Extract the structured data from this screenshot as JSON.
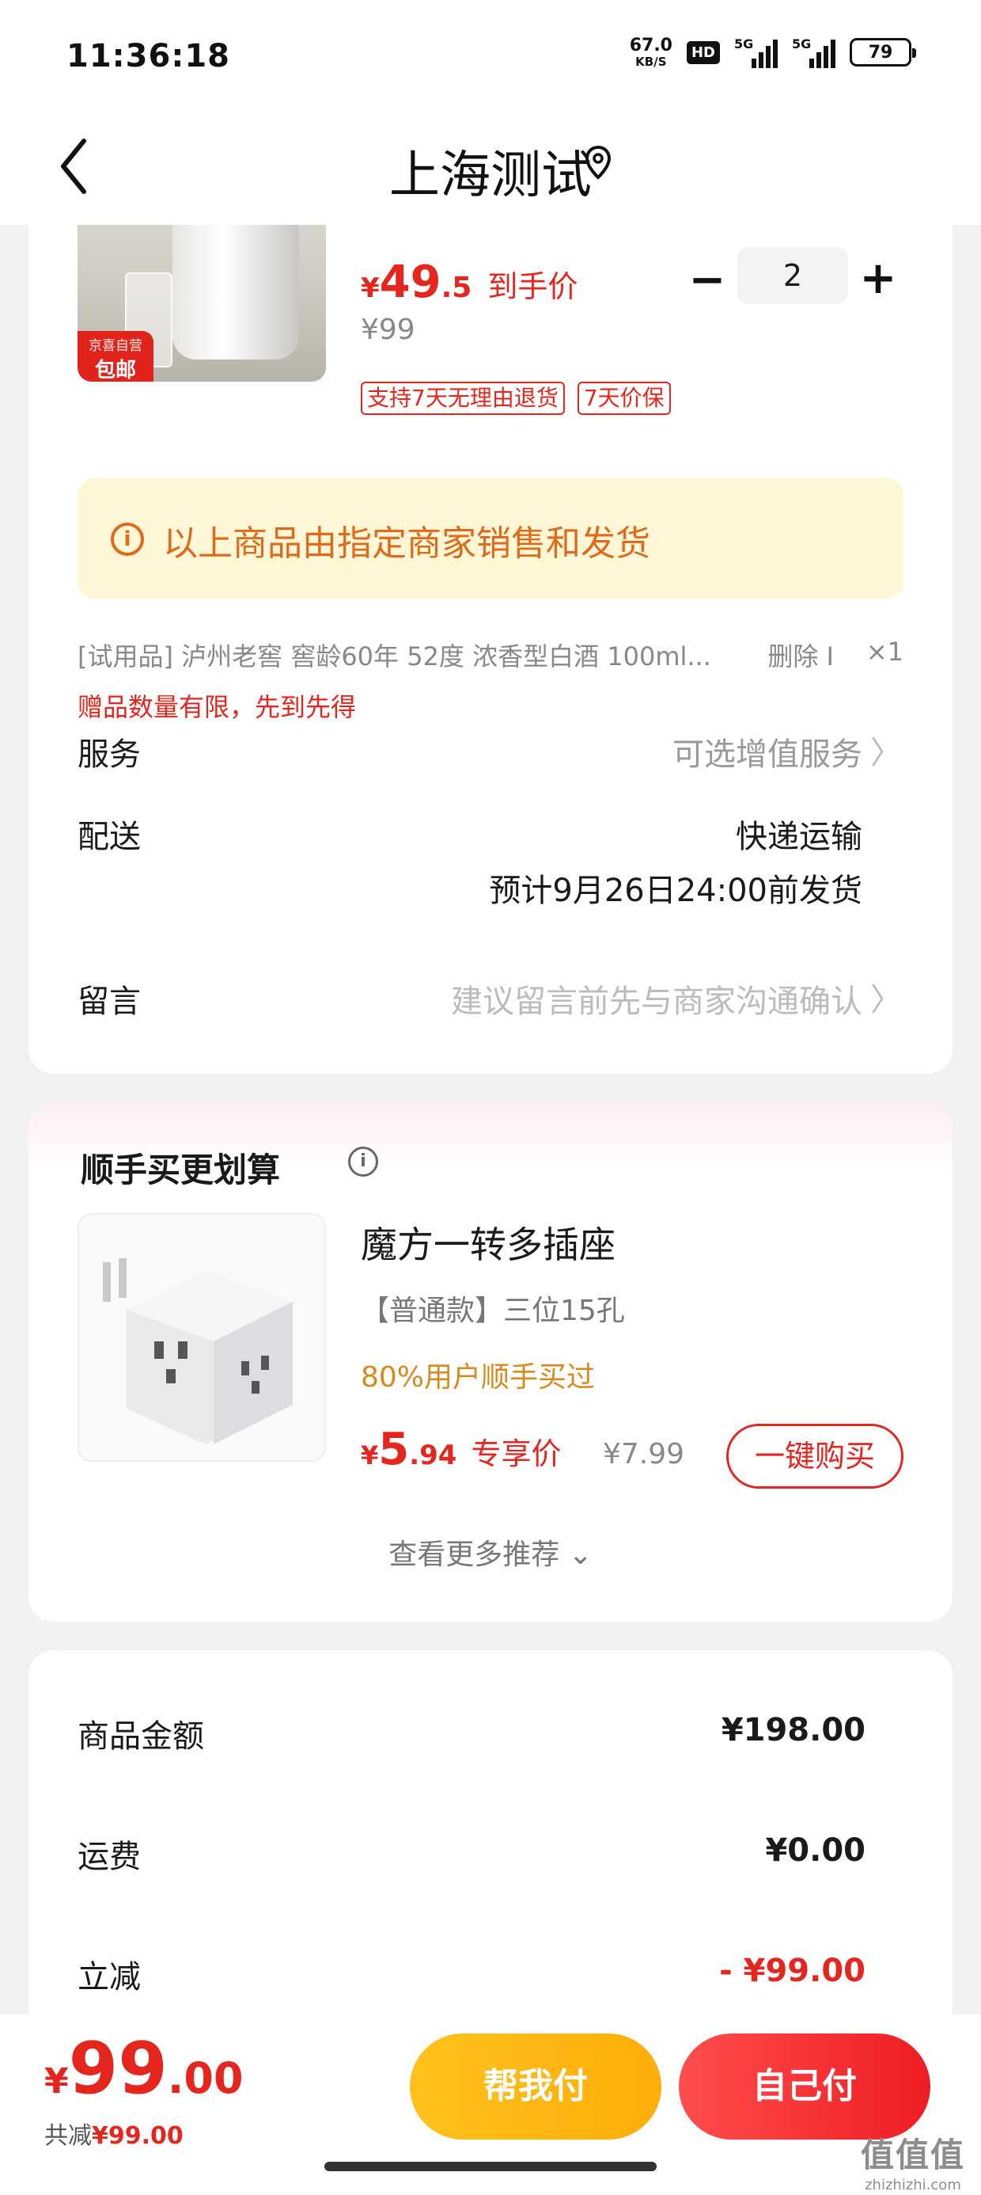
{
  "status_bar": {
    "time": "11:36:18",
    "net_speed_value": "67.0",
    "net_speed_unit": "KB/S",
    "hd": "HD",
    "signal1": "5G",
    "signal2": "5G",
    "battery": "79"
  },
  "header": {
    "title": "上海测试"
  },
  "product": {
    "badge_top": "京喜自营",
    "badge_bottom": "包邮",
    "price_symbol": "¥",
    "price_int": "49",
    "price_dec": ".5",
    "price_label": "到手价",
    "original_price": "¥99",
    "quantity": "2",
    "minus": "−",
    "plus": "+",
    "tags": [
      "支持7天无理由退货",
      "7天价保"
    ]
  },
  "notice": {
    "icon": "i",
    "text": "以上商品由指定商家销售和发货"
  },
  "gift": {
    "name": "[试用品]  泸州老窖 窖龄60年 52度 浓香型白酒 100ml...",
    "delete_label": "删除 I",
    "count": "×1",
    "note": "赠品数量有限，先到先得"
  },
  "service": {
    "label": "服务",
    "value": "可选增值服务"
  },
  "delivery": {
    "label": "配送",
    "method": "快递运输",
    "eta": "预计9月26日24:00前发货"
  },
  "message": {
    "label": "留言",
    "placeholder": "建议留言前先与商家沟通确认"
  },
  "recommend": {
    "title": "顺手买更划算",
    "info_icon": "i",
    "name": "魔方一转多插座",
    "spec": "【普通款】三位15孔",
    "popularity": "80%用户顺手买过",
    "price_symbol": "¥",
    "price_int": "5",
    "price_dec": ".94",
    "price_label": "专享价",
    "original_price": "¥7.99",
    "buy_label": "一键购买",
    "see_more": "查看更多推荐 ⌄"
  },
  "summary": {
    "goods_label": "商品金额",
    "goods_value": "¥198.00",
    "shipping_label": "运费",
    "shipping_value": "¥0.00",
    "discount_label": "立减",
    "discount_value": "- ¥99.00"
  },
  "bottom": {
    "total_symbol": "¥",
    "total_int": "99",
    "total_dec": ".00",
    "saved_label": "共减",
    "saved_value": "¥99.00",
    "help_pay": "帮我付",
    "self_pay": "自己付"
  },
  "watermark": {
    "line1": "值值值",
    "line2": "zhizhizhi.com"
  },
  "colors": {
    "accent_red": "#e5261e",
    "notice_bg": "#fff7d6",
    "notice_text": "#e06a1b",
    "help_btn": "#ffb710",
    "self_btn": "#f3262c"
  }
}
